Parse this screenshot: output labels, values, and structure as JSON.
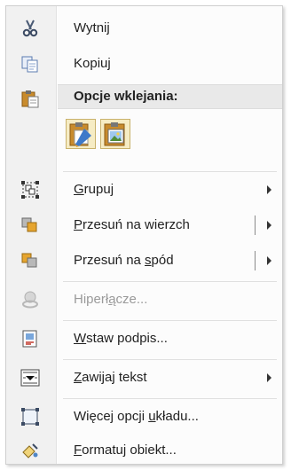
{
  "menu": {
    "items": [
      {
        "name": "cut",
        "label": "Wytnij",
        "icon": "scissors-icon"
      },
      {
        "name": "copy",
        "label": "Kopiuj",
        "icon": "copy-icon"
      },
      {
        "name": "paste-options-header",
        "label": "Opcje wklejania:",
        "icon": "clipboard-paste-icon"
      },
      {
        "name": "group",
        "label": "Grupuj",
        "icon": "group-objects-icon",
        "submenu": true
      },
      {
        "name": "bring-to-front",
        "label": "Przesuń na wierzch",
        "icon": "bring-to-front-icon",
        "submenu": true,
        "split": true
      },
      {
        "name": "send-to-back",
        "label": "Przesuń na spód",
        "icon": "send-to-back-icon",
        "submenu": true,
        "split": true
      },
      {
        "name": "hyperlink",
        "label": "Hiperłącze...",
        "icon": "hyperlink-icon",
        "disabled": true
      },
      {
        "name": "insert-caption",
        "label": "Wstaw podpis...",
        "icon": "insert-caption-icon"
      },
      {
        "name": "wrap-text",
        "label": "Zawijaj tekst",
        "icon": "wrap-text-icon",
        "submenu": true
      },
      {
        "name": "more-layout-options",
        "label": "Więcej opcji układu...",
        "icon": "layout-options-icon"
      },
      {
        "name": "format-object",
        "label": "Formatuj obiekt...",
        "icon": "format-object-icon"
      }
    ],
    "paste_options": [
      {
        "name": "paste-keep-formatting",
        "icon": "paste-keep-formatting-icon"
      },
      {
        "name": "paste-picture",
        "icon": "paste-picture-icon"
      }
    ],
    "colors": {
      "gutter": "#f1f1f1",
      "header_bg": "#e9e9e9",
      "text": "#222222",
      "disabled_text": "#9a9a9a"
    }
  }
}
